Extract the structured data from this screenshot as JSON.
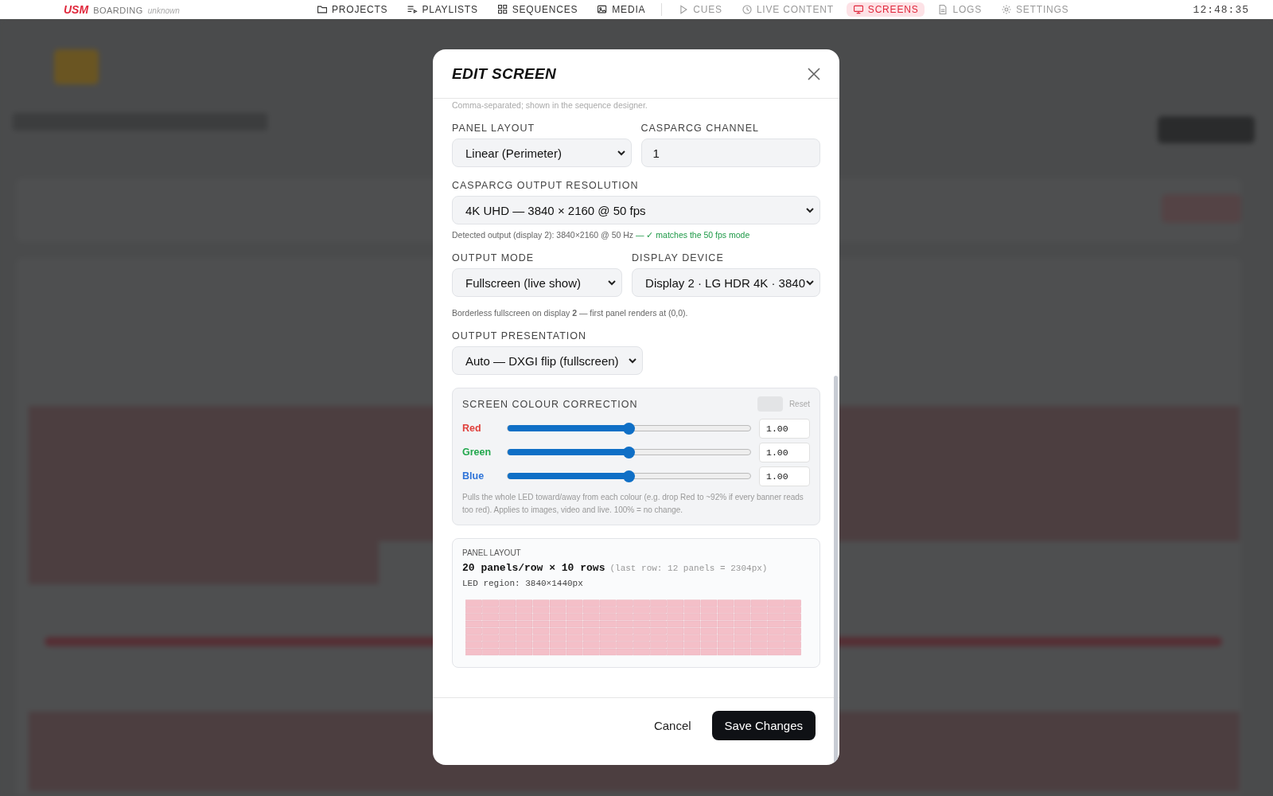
{
  "nav": {
    "logo": "USM",
    "app": "BOARDING",
    "venue": "unknown",
    "time": "12:48:35",
    "items": [
      {
        "label": "PROJECTS",
        "selected": false,
        "muted": false
      },
      {
        "label": "PLAYLISTS",
        "selected": false,
        "muted": false
      },
      {
        "label": "SEQUENCES",
        "selected": false,
        "muted": false
      },
      {
        "label": "MEDIA",
        "selected": false,
        "muted": false
      },
      {
        "label": "CUES",
        "selected": false,
        "muted": true
      },
      {
        "label": "LIVE CONTENT",
        "selected": false,
        "muted": true
      },
      {
        "label": "SCREENS",
        "selected": true,
        "muted": true
      },
      {
        "label": "LOGS",
        "selected": false,
        "muted": true
      },
      {
        "label": "SETTINGS",
        "selected": false,
        "muted": true
      }
    ]
  },
  "modal": {
    "title": "EDIT SCREEN",
    "top_hint": "Comma-separated; shown in the sequence designer.",
    "panel_layout": {
      "label": "PANEL LAYOUT",
      "value": "Linear (Perimeter)"
    },
    "channel": {
      "label": "CASPARCG CHANNEL",
      "value": "1"
    },
    "resolution": {
      "label": "CASPARCG OUTPUT RESOLUTION",
      "value": "4K UHD — 3840 × 2160 @ 50 fps",
      "hint": "Detected output (display 2): 3840×2160 @ 50 Hz",
      "status": "— ✓ matches the 50 fps mode"
    },
    "output_mode": {
      "label": "OUTPUT MODE",
      "value": "Fullscreen (live show)"
    },
    "display_device": {
      "label": "DISPLAY DEVICE",
      "value": "Display 2 · LG HDR 4K · 3840"
    },
    "mode_hint": "Borderless fullscreen on display **2** — first panel renders at (0,0).",
    "presentation": {
      "label": "OUTPUT PRESENTATION",
      "value": "Auto — DXGI flip (fullscreen)"
    },
    "colour": {
      "title": "SCREEN COLOUR CORRECTION",
      "reset": "Reset",
      "reset_disabled": true,
      "channels": [
        {
          "name": "Red",
          "color": "#e0403c",
          "level": 0.5,
          "value": "1.00"
        },
        {
          "name": "Green",
          "color": "#23a84e",
          "level": 0.5,
          "value": "1.00"
        },
        {
          "name": "Blue",
          "color": "#2f74d8",
          "level": 0.5,
          "value": "1.00"
        }
      ],
      "note": "Pulls the whole LED toward/away from each colour (e.g. drop Red to ~92% if every banner reads too red). Applies to images, video and live. 100% = no change."
    },
    "layout_preview": {
      "label": "PANEL LAYOUT",
      "summary": "20 panels/row × 10 rows",
      "detail": "(last row: 12 panels = 2304px)",
      "region": "LED region: 3840×1440px"
    },
    "cancel": "Cancel",
    "save": "Save Changes"
  }
}
